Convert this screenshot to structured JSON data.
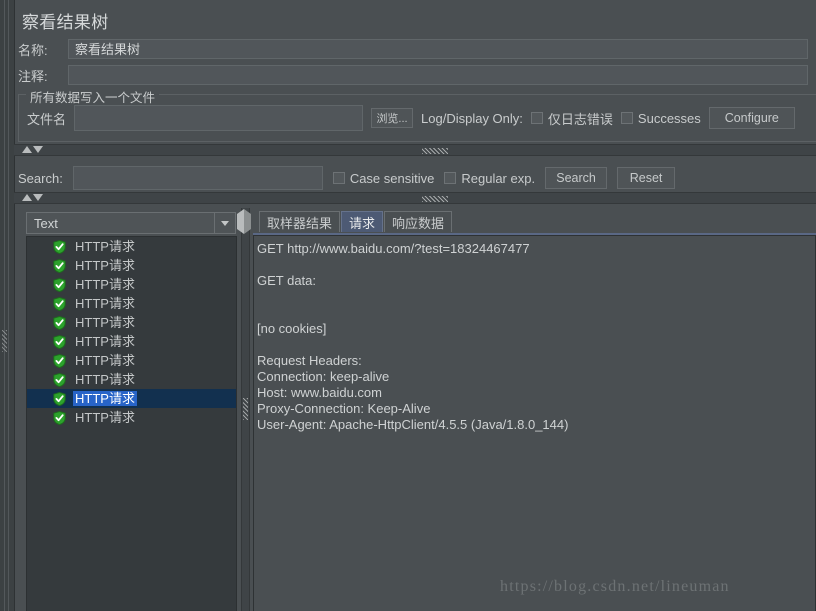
{
  "window": {
    "title": "察看结果树"
  },
  "form": {
    "name_label": "名称:",
    "name_value": "察看结果树",
    "comment_label": "注释:",
    "comment_value": ""
  },
  "file_group": {
    "legend": "所有数据写入一个文件",
    "filename_label": "文件名",
    "filename_value": "",
    "browse_button": "浏览...",
    "log_display_label": "Log/Display Only:",
    "errors_only_checkbox": "仅日志错误",
    "successes_checkbox": "Successes",
    "configure_button": "Configure"
  },
  "search": {
    "label": "Search:",
    "value": "",
    "case_sensitive_checkbox": "Case sensitive",
    "regular_exp_checkbox": "Regular exp.",
    "search_button": "Search",
    "reset_button": "Reset"
  },
  "renderer": {
    "selected": "Text"
  },
  "tree": {
    "items": [
      {
        "label": "HTTP请求",
        "selected": false
      },
      {
        "label": "HTTP请求",
        "selected": false
      },
      {
        "label": "HTTP请求",
        "selected": false
      },
      {
        "label": "HTTP请求",
        "selected": false
      },
      {
        "label": "HTTP请求",
        "selected": false
      },
      {
        "label": "HTTP请求",
        "selected": false
      },
      {
        "label": "HTTP请求",
        "selected": false
      },
      {
        "label": "HTTP请求",
        "selected": false
      },
      {
        "label": "HTTP请求",
        "selected": true
      },
      {
        "label": "HTTP请求",
        "selected": false
      }
    ]
  },
  "tabs": [
    {
      "label": "取样器结果",
      "active": false
    },
    {
      "label": "请求",
      "active": true
    },
    {
      "label": "响应数据",
      "active": false
    }
  ],
  "request_text": "GET http://www.baidu.com/?test=18324467477\n\nGET data:\n\n\n[no cookies]\n\nRequest Headers:\nConnection: keep-alive\nHost: www.baidu.com\nProxy-Connection: Keep-Alive\nUser-Agent: Apache-HttpClient/4.5.5 (Java/1.8.0_144)",
  "watermark": "https://blog.csdn.net/lineuman",
  "colors": {
    "background": "#4a4f52",
    "panel_dark": "#353a3d",
    "selection_blue": "#2864c8",
    "selection_row": "#12304f",
    "active_tab": "#4d5a74",
    "shield_green": "#2ca22c"
  }
}
